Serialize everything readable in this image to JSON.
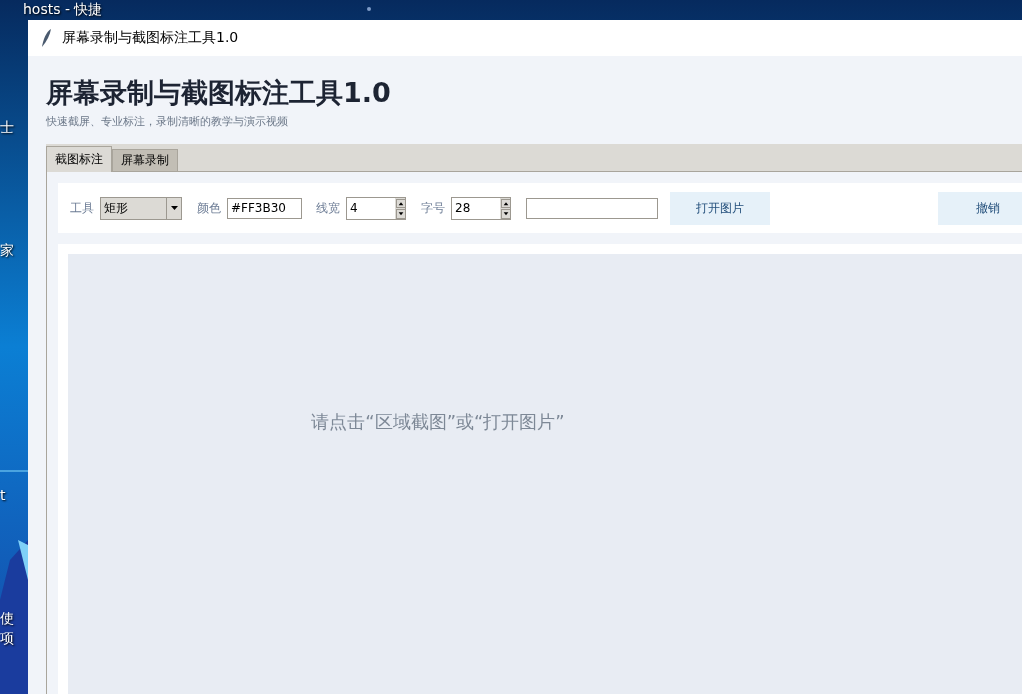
{
  "desktop": {
    "icon_labels": [
      "hosts - 快捷",
      "士",
      "家",
      "t",
      "使",
      "项"
    ]
  },
  "window": {
    "title": "屏幕录制与截图标注工具1.0"
  },
  "header": {
    "title": "屏幕录制与截图标注工具1.0",
    "subtitle": "快速截屏、专业标注，录制清晰的教学与演示视频"
  },
  "tabs": [
    {
      "label": "截图标注",
      "selected": true
    },
    {
      "label": "屏幕录制",
      "selected": false
    }
  ],
  "toolbar": {
    "tool_label": "工具",
    "tool_value": "矩形",
    "color_label": "颜色",
    "color_value": "#FF3B30",
    "line_width_label": "线宽",
    "line_width_value": "4",
    "font_size_label": "字号",
    "font_size_value": "28",
    "open_button": "打开图片",
    "undo_button": "撤销"
  },
  "canvas": {
    "hint": "请点击“区域截图”或“打开图片”"
  }
}
